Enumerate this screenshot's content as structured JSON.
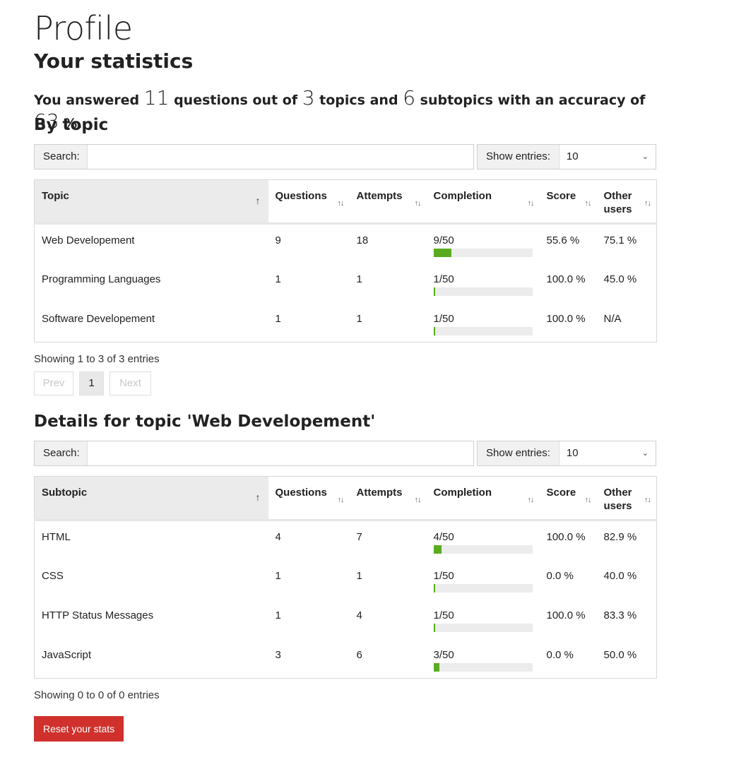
{
  "page": {
    "title": "Profile"
  },
  "stats": {
    "title": "Your statistics",
    "summary": {
      "prefix": "You answered",
      "questions": "11",
      "text1": "questions out of",
      "topics": "3",
      "text2": "topics and",
      "subtopics": "6",
      "text3": "subtopics with an accuracy of",
      "accuracy": "63",
      "suffix": "%."
    }
  },
  "colors": {
    "good": "#65b32e",
    "bad": "#c9302c",
    "bar": "#5aab1f",
    "reset": "#d0312d"
  },
  "by_topic": {
    "title": "By topic",
    "search_label": "Search:",
    "search_value": "",
    "entries_label": "Show entries:",
    "entries_value": "10",
    "columns": [
      "Topic",
      "Questions",
      "Attempts",
      "Completion",
      "Score",
      "Other users"
    ],
    "rows": [
      {
        "name": "Web Developement",
        "questions": "9",
        "attempts": "18",
        "completion": "9/50",
        "completion_fraction": 0.18,
        "score": "55.6 %",
        "score_status": "bad",
        "other": "75.1 %",
        "other_status": "good"
      },
      {
        "name": "Programming Languages",
        "questions": "1",
        "attempts": "1",
        "completion": "1/50",
        "completion_fraction": 0.02,
        "score": "100.0 %",
        "score_status": "good",
        "other": "45.0 %",
        "other_status": "bad"
      },
      {
        "name": "Software Developement",
        "questions": "1",
        "attempts": "1",
        "completion": "1/50",
        "completion_fraction": 0.02,
        "score": "100.0 %",
        "score_status": "neutral",
        "other": "N/A",
        "other_status": "neutral"
      }
    ],
    "info": "Showing 1 to 3 of 3 entries",
    "pager": {
      "prev": "Prev",
      "current": "1",
      "next": "Next"
    }
  },
  "details": {
    "title": "Details for topic 'Web Developement'",
    "search_label": "Search:",
    "search_value": "",
    "entries_label": "Show entries:",
    "entries_value": "10",
    "columns": [
      "Subtopic",
      "Questions",
      "Attempts",
      "Completion",
      "Score",
      "Other users"
    ],
    "rows": [
      {
        "name": "HTML",
        "questions": "4",
        "attempts": "7",
        "completion": "4/50",
        "completion_fraction": 0.08,
        "score": "100.0 %",
        "score_status": "good",
        "other": "82.9 %",
        "other_status": "bad"
      },
      {
        "name": "CSS",
        "questions": "1",
        "attempts": "1",
        "completion": "1/50",
        "completion_fraction": 0.02,
        "score": "0.0 %",
        "score_status": "bad",
        "other": "40.0 %",
        "other_status": "good"
      },
      {
        "name": "HTTP Status Messages",
        "questions": "1",
        "attempts": "4",
        "completion": "1/50",
        "completion_fraction": 0.02,
        "score": "100.0 %",
        "score_status": "good",
        "other": "83.3 %",
        "other_status": "bad"
      },
      {
        "name": "JavaScript",
        "questions": "3",
        "attempts": "6",
        "completion": "3/50",
        "completion_fraction": 0.06,
        "score": "0.0 %",
        "score_status": "bad",
        "other": "50.0 %",
        "other_status": "good"
      }
    ],
    "info": "Showing 0 to 0 of 0 entries"
  },
  "reset_button": {
    "label": "Reset your stats"
  }
}
